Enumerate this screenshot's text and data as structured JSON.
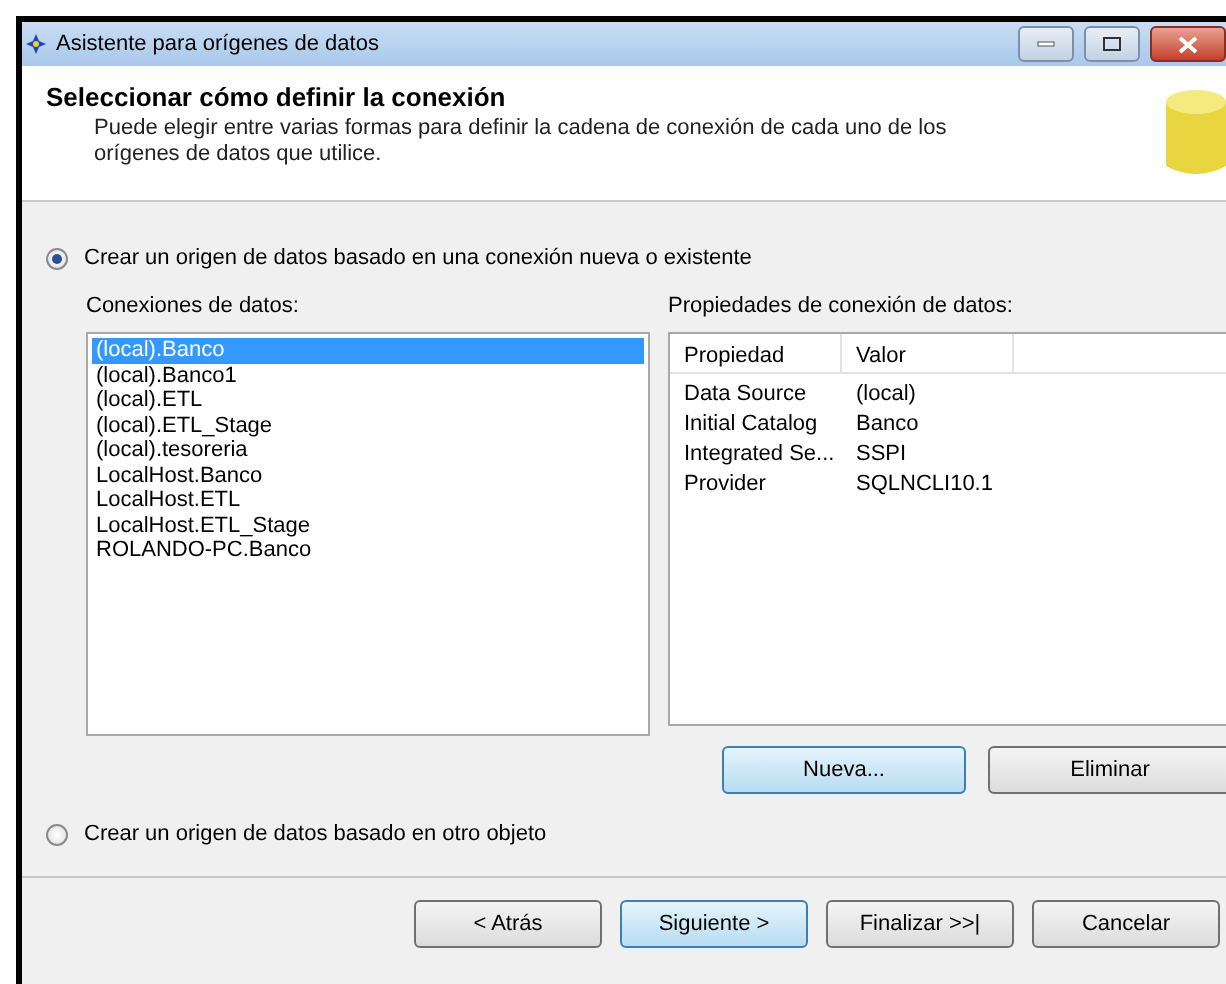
{
  "window": {
    "title": "Asistente para orígenes de datos"
  },
  "header": {
    "title": "Seleccionar cómo definir la conexión",
    "subtitle": "Puede elegir entre varias formas para definir la cadena de conexión de cada uno de los orígenes de datos que utilice."
  },
  "options": [
    {
      "label": "Crear un origen de datos basado en una conexión nueva o existente",
      "selected": true
    },
    {
      "label": "Crear un origen de datos basado en otro objeto",
      "selected": false
    }
  ],
  "connections": {
    "label": "Conexiones de datos:",
    "items": [
      {
        "label": "(local).Banco",
        "selected": true
      },
      {
        "label": "(local).Banco1",
        "selected": false
      },
      {
        "label": "(local).ETL",
        "selected": false
      },
      {
        "label": "(local).ETL_Stage",
        "selected": false
      },
      {
        "label": "(local).tesoreria",
        "selected": false
      },
      {
        "label": "LocalHost.Banco",
        "selected": false
      },
      {
        "label": "LocalHost.ETL",
        "selected": false
      },
      {
        "label": "LocalHost.ETL_Stage",
        "selected": false
      },
      {
        "label": "ROLANDO-PC.Banco",
        "selected": false
      }
    ]
  },
  "properties": {
    "label": "Propiedades de conexión de datos:",
    "columns": [
      "Propiedad",
      "Valor"
    ],
    "rows": [
      [
        "Data Source",
        "(local)"
      ],
      [
        "Initial Catalog",
        "Banco"
      ],
      [
        "Integrated Se...",
        "SSPI"
      ],
      [
        "Provider",
        "SQLNCLI10.1"
      ]
    ]
  },
  "connection_buttons": [
    {
      "label": "Nueva...",
      "focused": true
    },
    {
      "label": "Eliminar",
      "focused": false
    }
  ],
  "footer_buttons": [
    {
      "label": "< Atrás",
      "focused": false
    },
    {
      "label": "Siguiente >",
      "focused": true
    },
    {
      "label": "Finalizar >>|",
      "focused": false
    },
    {
      "label": "Cancelar",
      "focused": false
    }
  ]
}
